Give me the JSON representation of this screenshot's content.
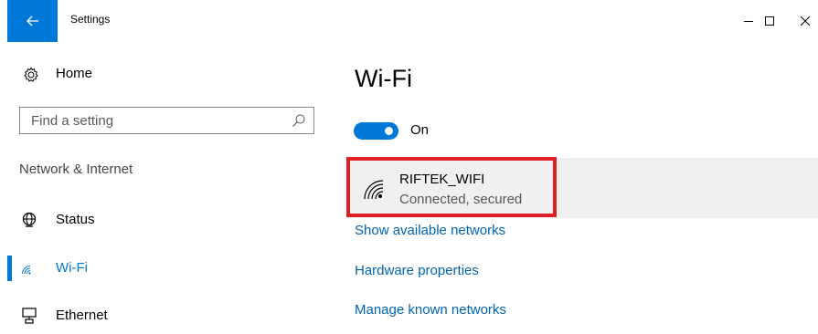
{
  "window": {
    "title": "Settings",
    "accent": "#0078d7"
  },
  "sidebar": {
    "home_label": "Home",
    "search_placeholder": "Find a setting",
    "section_heading": "Network & Internet",
    "items": [
      {
        "label": "Status",
        "icon": "globe-icon",
        "selected": false
      },
      {
        "label": "Wi-Fi",
        "icon": "wifi-icon",
        "selected": true
      },
      {
        "label": "Ethernet",
        "icon": "ethernet-icon",
        "selected": false
      }
    ]
  },
  "main": {
    "title": "Wi-Fi",
    "toggle_label": "On",
    "toggle_state": true,
    "network": {
      "name": "RIFTEK_WIFI",
      "status": "Connected, secured",
      "highlight_color": "#e01e26"
    },
    "links": {
      "available": "Show available networks",
      "hardware": "Hardware properties",
      "known": "Manage known networks"
    },
    "link_color": "#0063b1"
  }
}
